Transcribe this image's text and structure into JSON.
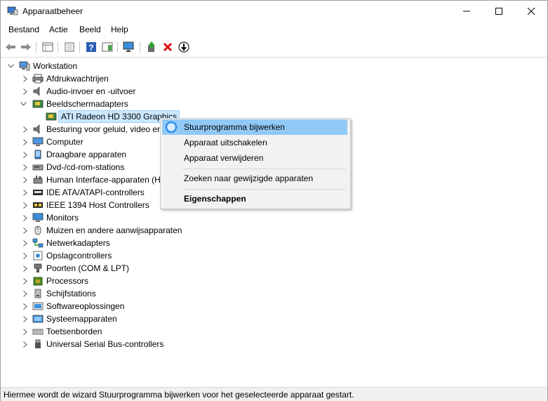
{
  "window": {
    "title": "Apparaatbeheer",
    "controls": [
      "minimize",
      "maximize",
      "close"
    ]
  },
  "menubar": {
    "items": [
      "Bestand",
      "Actie",
      "Beeld",
      "Help"
    ]
  },
  "toolbar": {
    "icons": [
      "back-icon",
      "forward-icon",
      "properties-pane-icon",
      "properties-icon",
      "help-icon",
      "action-pane-icon",
      "scan-monitor-icon",
      "update-driver-icon",
      "uninstall-x-icon",
      "disable-device-icon"
    ]
  },
  "tree": {
    "root": "Workstation",
    "items": [
      {
        "label": "Afdrukwachtrijen",
        "icon": "printer-icon",
        "expanded": false
      },
      {
        "label": "Audio-invoer en -uitvoer",
        "icon": "speaker-icon",
        "expanded": false
      },
      {
        "label": "Beeldschermadapters",
        "icon": "display-adapter-icon",
        "expanded": true
      },
      {
        "label": "ATI Radeon HD 3300 Graphics",
        "icon": "display-adapter-icon",
        "child": true,
        "selected": true
      },
      {
        "label": "Besturing voor geluid, video en spelletjes",
        "icon": "speaker-icon",
        "expanded": false
      },
      {
        "label": "Computer",
        "icon": "computer-icon",
        "expanded": false
      },
      {
        "label": "Draagbare apparaten",
        "icon": "portable-device-icon",
        "expanded": false
      },
      {
        "label": "Dvd-/cd-rom-stations",
        "icon": "dvd-drive-icon",
        "expanded": false
      },
      {
        "label": "Human Interface-apparaten (HID)",
        "icon": "hid-icon",
        "expanded": false
      },
      {
        "label": "IDE ATA/ATAPI-controllers",
        "icon": "ide-controller-icon",
        "expanded": false
      },
      {
        "label": "IEEE 1394 Host Controllers",
        "icon": "ieee1394-icon",
        "expanded": false
      },
      {
        "label": "Monitors",
        "icon": "monitor-icon",
        "expanded": false
      },
      {
        "label": "Muizen en andere aanwijsapparaten",
        "icon": "mouse-icon",
        "expanded": false
      },
      {
        "label": "Netwerkadapters",
        "icon": "network-icon",
        "expanded": false
      },
      {
        "label": "Opslagcontrollers",
        "icon": "storage-controller-icon",
        "expanded": false
      },
      {
        "label": "Poorten (COM & LPT)",
        "icon": "port-icon",
        "expanded": false
      },
      {
        "label": "Processors",
        "icon": "processor-icon",
        "expanded": false
      },
      {
        "label": "Schijfstations",
        "icon": "disk-drive-icon",
        "expanded": false
      },
      {
        "label": "Softwareoplossingen",
        "icon": "software-icon",
        "expanded": false
      },
      {
        "label": "Systeemapparaten",
        "icon": "system-device-icon",
        "expanded": false
      },
      {
        "label": "Toetsenborden",
        "icon": "keyboard-icon",
        "expanded": false
      },
      {
        "label": "Universal Serial Bus-controllers",
        "icon": "usb-icon",
        "expanded": false
      }
    ]
  },
  "context_menu": {
    "items": [
      {
        "label": "Stuurprogramma bijwerken",
        "highlighted": true
      },
      {
        "label": "Apparaat uitschakelen"
      },
      {
        "label": "Apparaat verwijderen"
      },
      {
        "label": "Zoeken naar gewijzigde apparaten"
      },
      {
        "label": "Eigenschappen",
        "bold": true
      }
    ]
  },
  "statusbar": {
    "text": "Hiermee wordt de wizard Stuurprogramma bijwerken voor het geselecteerde apparaat gestart."
  },
  "colors": {
    "selection_bg": "#cce8ff",
    "menu_highlight": "#91c9f7",
    "accent": "#0078d7"
  }
}
